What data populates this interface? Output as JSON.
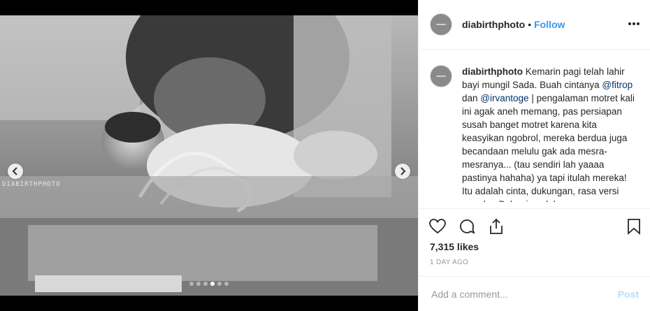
{
  "post": {
    "username": "diabirthphoto",
    "separator": "•",
    "follow_label": "Follow",
    "watermark": "DIABIRTHPHOTO",
    "carousel": {
      "dot_count": 6,
      "active_index": 3
    },
    "caption": {
      "username": "diabirthphoto",
      "text_1": "Kemarin pagi telah lahir bayi mungil Sada. Buah cintanya",
      "mention_1": "@fitrop",
      "text_2": "dan",
      "mention_2": "@irvantoge",
      "text_3": "| pengalaman motret kali ini agak aneh memang, pas persiapan susah banget motret karena kita keasyikan ngobrol, mereka berdua juga becandaan melulu gak ada mesra-mesranya... (tau sendiri lah yaaaa pastinya hahaha) ya tapi itulah mereka! Itu adalah cinta, dukungan, rasa versi mereka. Bahagia selalu yaaa"
    },
    "likes": "7,315 likes",
    "time": "1 DAY AGO",
    "comment_placeholder": "Add a comment...",
    "post_label": "Post"
  },
  "colors": {
    "accent": "#3897f0",
    "post_disabled": "#b2dffc",
    "mention": "#003569"
  },
  "icons": [
    "heart-icon",
    "comment-icon",
    "share-icon",
    "bookmark-icon",
    "more-icon",
    "chevron-left-icon",
    "chevron-right-icon"
  ]
}
